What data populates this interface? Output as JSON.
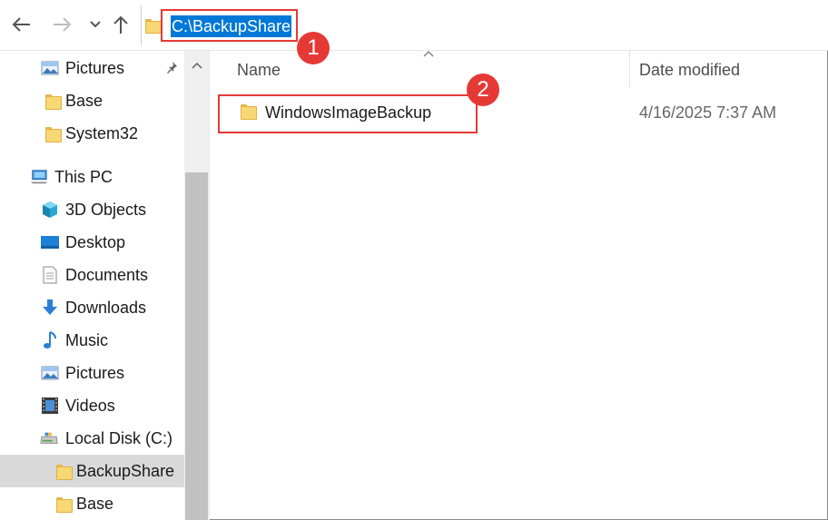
{
  "window": {
    "address_path": "C:\\BackupShare"
  },
  "nav": {
    "back_icon": "arrow-left-icon",
    "forward_icon": "arrow-right-icon",
    "recent_icon": "chevron-down-icon",
    "up_icon": "arrow-up-icon"
  },
  "sidebar": {
    "items": [
      {
        "label": "Pictures",
        "icon": "pictures-icon",
        "pinned": true
      },
      {
        "label": "Base",
        "icon": "folder-icon"
      },
      {
        "label": "System32",
        "icon": "folder-icon"
      },
      {
        "label": "This PC",
        "icon": "computer-icon"
      },
      {
        "label": "3D Objects",
        "icon": "3d-objects-icon"
      },
      {
        "label": "Desktop",
        "icon": "desktop-icon"
      },
      {
        "label": "Documents",
        "icon": "documents-icon"
      },
      {
        "label": "Downloads",
        "icon": "downloads-icon"
      },
      {
        "label": "Music",
        "icon": "music-icon"
      },
      {
        "label": "Pictures",
        "icon": "pictures-icon"
      },
      {
        "label": "Videos",
        "icon": "videos-icon"
      },
      {
        "label": "Local Disk (C:)",
        "icon": "drive-icon"
      },
      {
        "label": "BackupShare",
        "icon": "folder-icon",
        "selected": true
      },
      {
        "label": "Base",
        "icon": "folder-icon"
      }
    ]
  },
  "columns": {
    "name": "Name",
    "date_modified": "Date modified"
  },
  "files": [
    {
      "name": "WindowsImageBackup",
      "date_modified": "4/16/2025 7:37 AM",
      "icon": "folder-icon"
    }
  ],
  "annotations": {
    "step1": "1",
    "step2": "2",
    "color": "#e53935"
  },
  "colors": {
    "selection": "#0078d7",
    "sidebar_selected": "#d9d9d9"
  }
}
